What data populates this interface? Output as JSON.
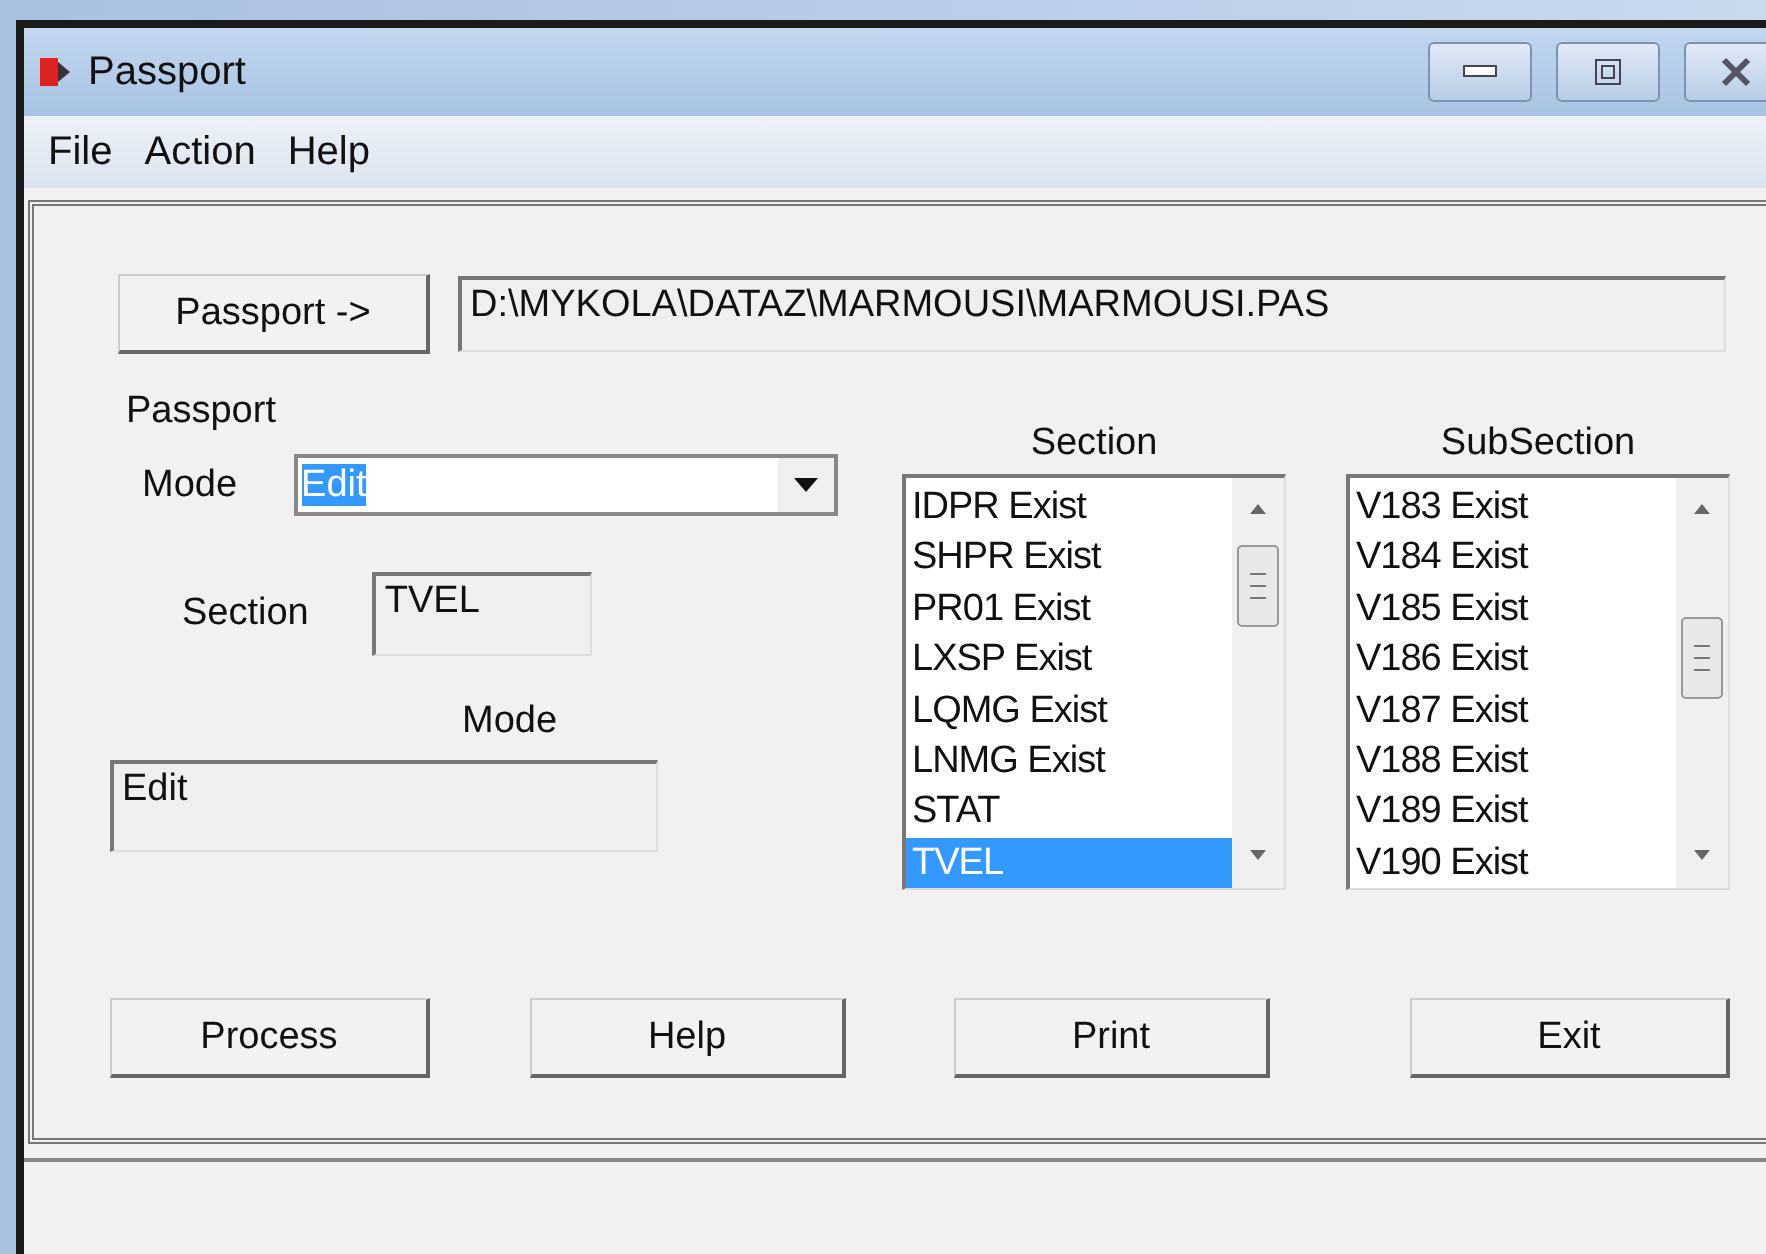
{
  "window": {
    "title": "Passport"
  },
  "menu": [
    {
      "label": "File"
    },
    {
      "label": "Action"
    },
    {
      "label": "Help"
    }
  ],
  "passport_button": "Passport ->",
  "path": "D:\\MYKOLA\\DATAZ\\MARMOUSI\\MARMOUSI.PAS",
  "group_label": "Passport",
  "mode_select": {
    "label": "Mode",
    "value": "Edit"
  },
  "section_field": {
    "label": "Section",
    "value": "TVEL"
  },
  "mode_field": {
    "label": "Mode",
    "value": "Edit"
  },
  "section_list": {
    "title": "Section",
    "items": [
      {
        "label": "IDPR Exist",
        "selected": false
      },
      {
        "label": "SHPR Exist",
        "selected": false
      },
      {
        "label": "PR01 Exist",
        "selected": false
      },
      {
        "label": "LXSP Exist",
        "selected": false
      },
      {
        "label": "LQMG Exist",
        "selected": false
      },
      {
        "label": "LNMG Exist",
        "selected": false
      },
      {
        "label": "STAT",
        "selected": false
      },
      {
        "label": "TVEL",
        "selected": true
      }
    ]
  },
  "subsection_list": {
    "title": "SubSection",
    "items": [
      {
        "label": "V183 Exist",
        "selected": false
      },
      {
        "label": "V184 Exist",
        "selected": false
      },
      {
        "label": "V185 Exist",
        "selected": false
      },
      {
        "label": "V186 Exist",
        "selected": false
      },
      {
        "label": "V187 Exist",
        "selected": false
      },
      {
        "label": "V188 Exist",
        "selected": false
      },
      {
        "label": "V189 Exist",
        "selected": false
      },
      {
        "label": "V190 Exist",
        "selected": false
      }
    ]
  },
  "buttons": [
    {
      "label": "Process"
    },
    {
      "label": "Help"
    },
    {
      "label": "Print"
    },
    {
      "label": "Exit"
    }
  ]
}
